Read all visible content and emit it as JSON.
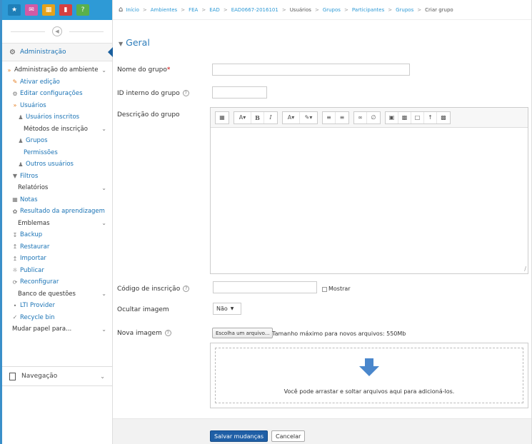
{
  "topbar": {
    "icons": [
      "home-icon",
      "mail-icon",
      "calendar-icon",
      "book-icon",
      "help-icon"
    ]
  },
  "admin_block": {
    "title": "Administração"
  },
  "tree": {
    "admin_env": "Administração do ambiente",
    "enable_edit": "Ativar edição",
    "edit_settings": "Editar configurações",
    "users": "Usuários",
    "enrolled_users": "Usuários inscritos",
    "enrol_methods": "Métodos de inscrição",
    "groups": "Grupos",
    "permissions": "Permissões",
    "other_users": "Outros usuários",
    "filters": "Filtros",
    "reports": "Relatórios",
    "grades": "Notas",
    "outcomes": "Resultado da aprendizagem",
    "badges": "Emblemas",
    "backup": "Backup",
    "restore": "Restaurar",
    "import": "Importar",
    "publish": "Publicar",
    "reset": "Reconfigurar",
    "question_bank": "Banco de questões",
    "lti": "LTI Provider",
    "recycle": "Recycle bin",
    "switch_role": "Mudar papel para..."
  },
  "nav_block": {
    "title": "Navegação"
  },
  "breadcrumb": {
    "items": [
      "Início",
      "Ambientes",
      "FEA",
      "EAD",
      "EAD0667-2016101",
      "Usuários",
      "Grupos",
      "Participantes",
      "Grupos"
    ],
    "current": "Criar grupo"
  },
  "form": {
    "section_title": "Geral",
    "group_name_label": "Nome do grupo",
    "group_name_required": "*",
    "group_name_value": "",
    "id_label": "ID interno do grupo",
    "id_value": "",
    "description_label": "Descrição do grupo",
    "enrolment_key_label": "Código de inscrição",
    "enrolment_key_value": "",
    "show_label": "Mostrar",
    "hide_picture_label": "Ocultar imagem",
    "hide_picture_value": "Não",
    "new_picture_label": "Nova imagem",
    "choose_file_label": "Escolha um arquivo...",
    "max_size_note": "Tamanho máximo para novos arquivos: 550Mb",
    "drop_text": "Você pode arrastar e soltar arquivos aqui para adicioná-los."
  },
  "actions": {
    "save_label": "Salvar mudanças",
    "cancel_label": "Cancelar"
  },
  "colors": {
    "topbar": "#2e9ad6",
    "link": "#1a73b5",
    "primary_button": "#1f5fa6",
    "drop_arrow": "#4a87cc"
  }
}
